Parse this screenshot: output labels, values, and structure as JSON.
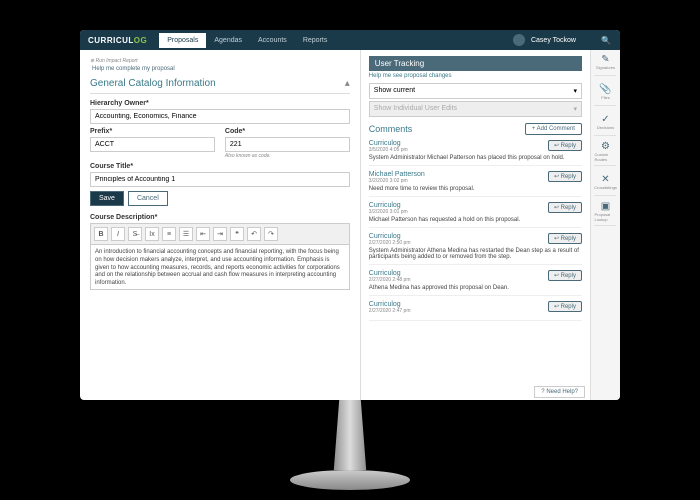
{
  "nav": {
    "logo_a": "CURRICUL",
    "logo_b": "OG",
    "tabs": [
      "Proposals",
      "Agendas",
      "Accounts",
      "Reports"
    ],
    "user": "Casey Tockow"
  },
  "left": {
    "impact": "Run Impact Report",
    "help": "Help me complete my proposal",
    "section": "General Catalog Information",
    "hierarchy_lbl": "Hierarchy Owner*",
    "hierarchy_val": "Accounting, Economics, Finance",
    "prefix_lbl": "Prefix*",
    "prefix_val": "ACCT",
    "code_lbl": "Code*",
    "code_val": "221",
    "code_hint": "Also known as code.",
    "title_lbl": "Course Title*",
    "title_val": "Principles of Accounting 1",
    "save": "Save",
    "cancel": "Cancel",
    "desc_lbl": "Course Description*",
    "desc_val": "An introduction to financial accounting concepts and financial reporting, with the focus being on how decision makers analyze, interpret, and use accounting information. Emphasis is given to how accounting measures, records, and reports economic activities for corporations and on the relationship between accrual and cash flow measures in interpreting accounting information."
  },
  "right": {
    "track_title": "User Tracking",
    "track_help": "Help me see proposal changes",
    "dd1": "Show current",
    "dd2": "Show Individual User Edits",
    "comments_title": "Comments",
    "add_comment": "+ Add Comment",
    "reply": "Reply",
    "comments": [
      {
        "user": "Curriculog",
        "date": "3/5/2020 4:05 pm",
        "text": "System Administrator Michael Patterson has placed this proposal on hold."
      },
      {
        "user": "Michael Patterson",
        "date": "3/2/2020 3:02 pm",
        "text": "Need more time to review this proposal."
      },
      {
        "user": "Curriculog",
        "date": "3/2/2020 3:01 pm",
        "text": "Michael Patterson has requested a hold on this proposal."
      },
      {
        "user": "Curriculog",
        "date": "2/27/2020 2:50 pm",
        "text": "System Administrator Athena Medina has restarted the Dean step as a result of participants being added to or removed from the step."
      },
      {
        "user": "Curriculog",
        "date": "2/27/2020 2:48 pm",
        "text": "Athena Medina has approved this proposal on Dean."
      },
      {
        "user": "Curriculog",
        "date": "2/27/2020 2:47 pm",
        "text": ""
      }
    ],
    "need_help": "Need Help?"
  },
  "sidebar": {
    "items": [
      "Signatures",
      "Files",
      "Decisions",
      "Custom Routes",
      "Crosslistings",
      "Proposal Lookup"
    ]
  }
}
